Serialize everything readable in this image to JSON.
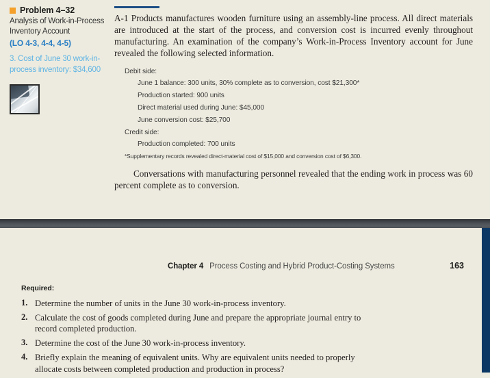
{
  "margin_notes": {
    "problem_label": "Problem 4–32",
    "problem_subtitle": "Analysis of Work-in-Process Inventory Account",
    "learning_objectives": "(LO 4-3, 4-4, 4-5)",
    "answer_hint": "3. Cost of June 30 work-in-process inventory: $34,600",
    "photo_alt": "photograph of wooden furniture assembly line",
    "colors": {
      "marker_orange": "#f5a02a",
      "lo_blue": "#2a7fc4",
      "hint_blue": "#5fb4e5"
    }
  },
  "problem_body": {
    "intro_paragraph": "A-1 Products manufactures wooden furniture using an assembly-line process. All direct materials are introduced at the start of the process, and conversion cost is incurred evenly throughout manufacturing. An examination of the company’s Work-in-Process Inventory account for June revealed the following selected information.",
    "data": {
      "debit_heading": "Debit side:",
      "debit_items": [
        "June 1 balance: 300 units, 30% complete as to conversion, cost $21,300*",
        "Production started: 900 units",
        "Direct material used during June: $45,000",
        "June conversion cost: $25,700"
      ],
      "credit_heading": "Credit side:",
      "credit_items": [
        "Production completed: 700 units"
      ],
      "footnote": "*Supplementary records revealed direct-material cost of $15,000 and conversion cost of $6,300."
    },
    "closing_paragraph": "Conversations with manufacturing personnel revealed that the ending work in process was 60 percent complete as to conversion."
  },
  "running_head": {
    "chapter": "Chapter 4",
    "title": "Process Costing and Hybrid Product-Costing Systems",
    "page_number": "163"
  },
  "required": {
    "label": "Required:",
    "items": [
      {
        "number": "1.",
        "text": "Determine the number of units in the June 30 work-in-process inventory."
      },
      {
        "number": "2.",
        "text": "Calculate the cost of goods completed during June and prepare the appropriate journal entry to record completed production."
      },
      {
        "number": "3.",
        "text": "Determine the cost of the June 30 work-in-process inventory."
      },
      {
        "number": "4.",
        "text": "Briefly explain the meaning of equivalent units. Why are equivalent units needed to properly allocate costs between completed production and production in process?"
      }
    ]
  },
  "decor": {
    "page_background": "#edebdf",
    "divider_band_color": "#4d5359",
    "right_bar_color": "#0b3765",
    "rule_color": "#1d4f86"
  }
}
